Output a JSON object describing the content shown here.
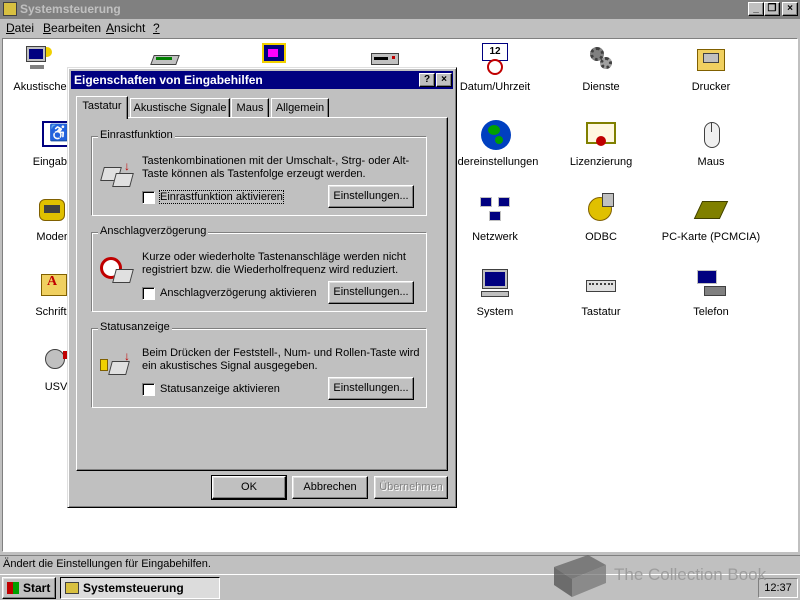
{
  "window": {
    "title": "Systemsteuerung",
    "buttons": [
      "_",
      "❐",
      "×"
    ]
  },
  "menubar": [
    {
      "label": "Datei",
      "accel": "D",
      "rest": "atei"
    },
    {
      "label": "Bearbeiten",
      "accel": "B",
      "rest": "earbeiten"
    },
    {
      "label": "Ansicht",
      "accel": "A",
      "rest": "nsicht"
    },
    {
      "label": "?",
      "accel": "?",
      "rest": ""
    }
  ],
  "icons": [
    {
      "label": "Akustische",
      "icon": "speaker-monitor-icon"
    },
    {
      "label": "",
      "icon": "network-card-icon"
    },
    {
      "label": "",
      "icon": "display-icon"
    },
    {
      "label": "",
      "icon": "drive-icon"
    },
    {
      "label": "Datum/Uhrzeit",
      "icon": "calendar-clock-icon"
    },
    {
      "label": "Dienste",
      "icon": "gears-icon"
    },
    {
      "label": "Drucker",
      "icon": "printer-folder-icon"
    },
    {
      "label": "Eingabeh",
      "icon": "accessibility-icon"
    },
    {
      "label": "ndereinstellungen",
      "icon": "globe-icon"
    },
    {
      "label": "Lizenzierung",
      "icon": "certificate-icon"
    },
    {
      "label": "Maus",
      "icon": "mouse-icon"
    },
    {
      "label": "Moder",
      "icon": "telephone-modem-icon"
    },
    {
      "label": "Netzwerk",
      "icon": "network-icon"
    },
    {
      "label": "ODBC",
      "icon": "odbc-icon"
    },
    {
      "label": "PC-Karte (PCMCIA)",
      "icon": "pc-card-icon"
    },
    {
      "label": "Schrifta",
      "icon": "fonts-folder-icon"
    },
    {
      "label": "System",
      "icon": "computer-icon"
    },
    {
      "label": "Tastatur",
      "icon": "keyboard-icon"
    },
    {
      "label": "Telefon",
      "icon": "telephone-icon"
    },
    {
      "label": "USV",
      "icon": "ups-plug-icon"
    }
  ],
  "dialog": {
    "title": "Eigenschaften von Eingabehilfen",
    "tabs": [
      "Tastatur",
      "Akustische Signale",
      "Maus",
      "Allgemein"
    ],
    "groups": [
      {
        "title": "Einrastfunktion",
        "description": "Tastenkombinationen mit der Umschalt-, Strg- oder Alt-Taste können als Tastenfolge erzeugt werden.",
        "checkbox": "Einrastfunktion aktivieren",
        "button": "Einstellungen..."
      },
      {
        "title": "Anschlagverzögerung",
        "description": "Kurze oder wiederholte Tastenanschläge werden nicht registriert bzw. die Wiederholfrequenz wird reduziert.",
        "checkbox": "Anschlagverzögerung aktivieren",
        "button": "Einstellungen..."
      },
      {
        "title": "Statusanzeige",
        "description": "Beim Drücken der Feststell-, Num- und Rollen-Taste wird ein akustisches Signal ausgegeben.",
        "checkbox": "Statusanzeige aktivieren",
        "button": "Einstellungen..."
      }
    ],
    "ok": "OK",
    "cancel": "Abbrechen",
    "apply": "Übernehmen",
    "help": "?",
    "close": "×"
  },
  "statusbar": {
    "text": "Ändert die Einstellungen für Eingabehilfen."
  },
  "taskbar": {
    "start": "Start",
    "task": "Systemsteuerung",
    "clock": "12:37"
  },
  "watermark": {
    "text": "The Collection Book"
  },
  "colors": {
    "face": "#c0c0c0",
    "active_title": "#000080",
    "inactive_title": "#808080",
    "window_bg": "#ffffff"
  }
}
